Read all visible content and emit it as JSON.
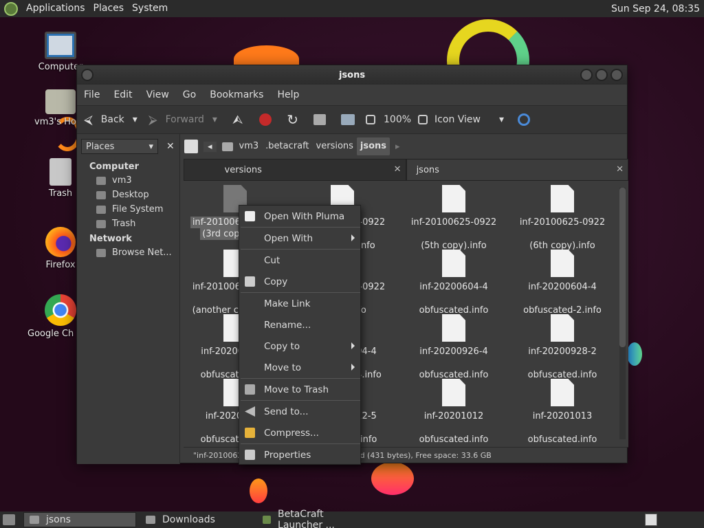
{
  "topbar": {
    "menus": [
      "Applications",
      "Places",
      "System"
    ],
    "clock": "Sun Sep 24, 08:35"
  },
  "desktop_icons": [
    {
      "label": "Computer",
      "icon": "computer-icon"
    },
    {
      "label": "vm3's Home",
      "icon": "home-folder-icon"
    },
    {
      "label": "Trash",
      "icon": "trash-icon"
    },
    {
      "label": "Firefox",
      "icon": "firefox-icon"
    },
    {
      "label": "Google Chrome",
      "icon": "chrome-icon"
    }
  ],
  "window": {
    "title": "jsons"
  },
  "menubar": [
    "File",
    "Edit",
    "View",
    "Go",
    "Bookmarks",
    "Help"
  ],
  "toolbar": {
    "back": "Back",
    "forward": "Forward",
    "zoom": "100%",
    "view_mode": "Icon View"
  },
  "sidebar": {
    "combo": "Places",
    "sections": [
      {
        "title": "Computer",
        "items": [
          "vm3",
          "Desktop",
          "File System",
          "Trash"
        ]
      },
      {
        "title": "Network",
        "items": [
          "Browse Net..."
        ]
      }
    ]
  },
  "path": [
    "vm3",
    ".betacraft",
    "versions",
    "jsons"
  ],
  "tabs": [
    {
      "label": "versions",
      "active": false
    },
    {
      "label": "jsons",
      "active": true
    }
  ],
  "files": [
    {
      "line1": "inf-20100625-0922",
      "line2": "(3rd copy).info"
    },
    {
      "line1": "inf-20100625-0922",
      "line2": "(4th copy).info"
    },
    {
      "line1": "inf-20100625-0922",
      "line2": "(5th copy).info"
    },
    {
      "line1": "inf-20100625-0922",
      "line2": "(6th copy).info"
    },
    {
      "line1": "inf-20100625-0922",
      "line2": "(another copy).info"
    },
    {
      "line1": "inf-20100625-0922",
      "line2": "(copy).info"
    },
    {
      "line1": "inf-20200604-4",
      "line2": "obfuscated.info"
    },
    {
      "line1": "inf-20200604-4",
      "line2": "obfuscated-2.info"
    },
    {
      "line1": "inf-20200724-4",
      "line2": "obfuscated.info"
    },
    {
      "line1": "inf-20200804-4",
      "line2": "obfuscated-4.info"
    },
    {
      "line1": "inf-20200926-4",
      "line2": "obfuscated.info"
    },
    {
      "line1": "inf-20200928-2",
      "line2": "obfuscated.info"
    },
    {
      "line1": "inf-20201008",
      "line2": "obfuscated.info"
    },
    {
      "line1": "inf-20201012-5",
      "line2": "obfuscated.info"
    },
    {
      "line1": "inf-20201012",
      "line2": "obfuscated.info"
    },
    {
      "line1": "inf-20201013",
      "line2": "obfuscated.info"
    }
  ],
  "status": "\"inf-20100625-0922 (3rd copy).info\" selected (431 bytes), Free space: 33.6 GB",
  "context_menu": [
    {
      "label": "Open With Pluma",
      "icon": "pluma-icon",
      "sub": false,
      "sep_after": true
    },
    {
      "label": "Open With",
      "icon": "",
      "sub": true,
      "sep_after": true
    },
    {
      "label": "Cut",
      "icon": "scissors-icon",
      "sub": false,
      "sep_after": false
    },
    {
      "label": "Copy",
      "icon": "copy-icon",
      "sub": false,
      "sep_after": true
    },
    {
      "label": "Make Link",
      "icon": "",
      "sub": false,
      "sep_after": false
    },
    {
      "label": "Rename...",
      "icon": "",
      "sub": false,
      "sep_after": false
    },
    {
      "label": "Copy to",
      "icon": "",
      "sub": true,
      "sep_after": false
    },
    {
      "label": "Move to",
      "icon": "",
      "sub": true,
      "sep_after": true
    },
    {
      "label": "Move to Trash",
      "icon": "trash-icon",
      "sub": false,
      "sep_after": true
    },
    {
      "label": "Send to...",
      "icon": "send-icon",
      "sub": false,
      "sep_after": false
    },
    {
      "label": "Compress...",
      "icon": "archive-icon",
      "sub": false,
      "sep_after": true
    },
    {
      "label": "Properties",
      "icon": "properties-icon",
      "sub": false,
      "sep_after": false
    }
  ],
  "taskbar": [
    {
      "label": "jsons",
      "active": true
    },
    {
      "label": "Downloads",
      "active": false
    },
    {
      "label": "BetaCraft Launcher ...",
      "active": false
    }
  ]
}
